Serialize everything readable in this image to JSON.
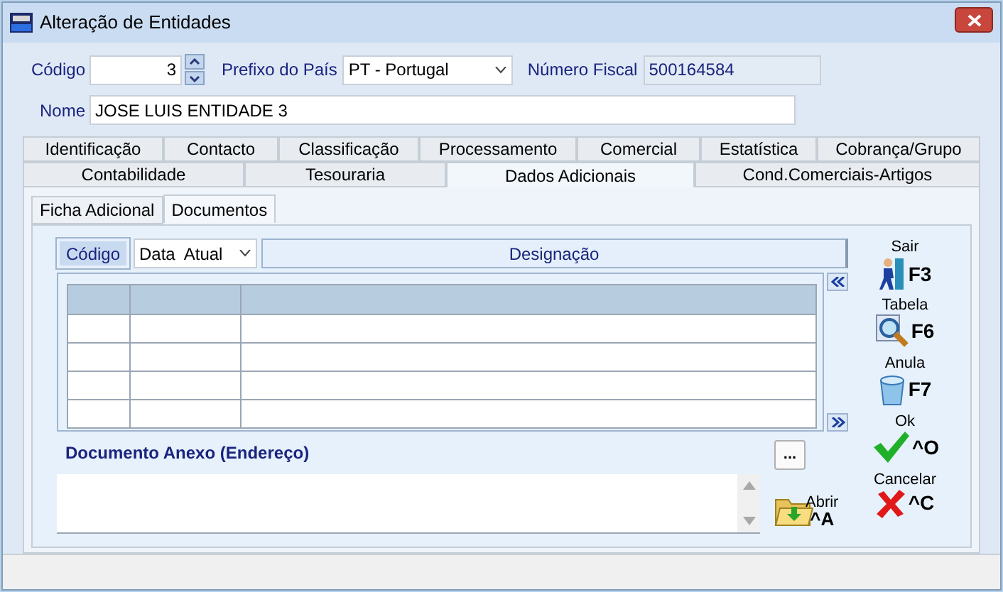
{
  "window": {
    "title": "Alteração de Entidades"
  },
  "header": {
    "codigo_label": "Código",
    "codigo_value": "3",
    "prefixo_label": "Prefixo do País",
    "prefixo_value": "PT - Portugal",
    "nif_label": "Número Fiscal",
    "nif_value": "500164584",
    "nome_label": "Nome",
    "nome_value": "JOSE LUIS ENTIDADE 3"
  },
  "tab_rows": [
    [
      {
        "label": "Identificação",
        "selected": false
      },
      {
        "label": "Contacto",
        "selected": false
      },
      {
        "label": "Classificação",
        "selected": false
      },
      {
        "label": "Processamento",
        "selected": false
      },
      {
        "label": "Comercial",
        "selected": false
      },
      {
        "label": "Estatística",
        "selected": false
      },
      {
        "label": "Cobrança/Grupo",
        "selected": false
      }
    ],
    [
      {
        "label": "Contabilidade",
        "selected": false
      },
      {
        "label": "Tesouraria",
        "selected": false
      },
      {
        "label": "Dados Adicionais",
        "selected": true
      },
      {
        "label": "Cond.Comerciais-Artigos",
        "selected": false
      }
    ]
  ],
  "subtabs": [
    {
      "label": "Ficha Adicional",
      "selected": false
    },
    {
      "label": "Documentos",
      "selected": true
    }
  ],
  "grid_toolbar": {
    "sort_button": "Código",
    "date_select": "Data  Atual",
    "column_header": "Designação"
  },
  "attachment": {
    "label": "Documento Anexo (Endereço)",
    "browse_button": "...",
    "open_label": "Abrir",
    "open_key": "^A"
  },
  "actions": [
    {
      "kind": "exit",
      "label": "Sair",
      "key": "F3"
    },
    {
      "kind": "table",
      "label": "Tabela",
      "key": "F6"
    },
    {
      "kind": "cancel-record",
      "label": "Anula",
      "key": "F7"
    },
    {
      "kind": "ok",
      "label": "Ok",
      "key": "^O"
    },
    {
      "kind": "cancel",
      "label": "Cancelar",
      "key": "^C"
    }
  ]
}
